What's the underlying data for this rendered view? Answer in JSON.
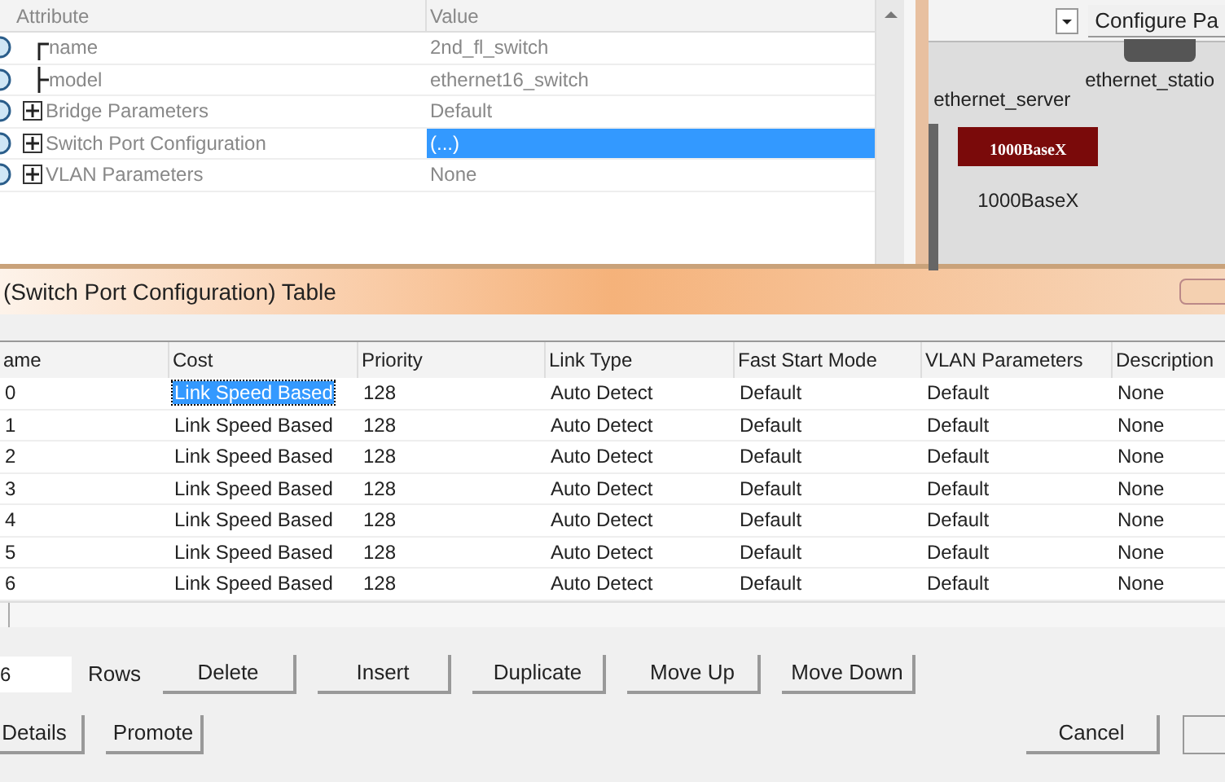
{
  "attributes_panel": {
    "columns": [
      "Attribute",
      "Value"
    ],
    "rows": [
      {
        "kind": "leaf",
        "attribute": "name",
        "value": "2nd_fl_switch",
        "selected": false
      },
      {
        "kind": "leaf",
        "attribute": "model",
        "value": "ethernet16_switch",
        "selected": false
      },
      {
        "kind": "group",
        "attribute": "Bridge Parameters",
        "value": "Default",
        "selected": false
      },
      {
        "kind": "group",
        "attribute": "Switch Port Configuration",
        "value": "(...)",
        "selected": true
      },
      {
        "kind": "group",
        "attribute": "VLAN Parameters",
        "value": "None",
        "selected": false
      }
    ]
  },
  "canvas": {
    "configure_button": "Configure Pa",
    "nodes": [
      "ethernet_server",
      "ethernet_statio"
    ],
    "link_badge": "1000BaseX",
    "link_label": "1000BaseX"
  },
  "dialog": {
    "title": "(Switch Port Configuration) Table",
    "table": {
      "columns": [
        "ame",
        "Cost",
        "Priority",
        "Link Type",
        "Fast Start Mode",
        "VLAN Parameters",
        "Description"
      ],
      "rows": [
        {
          "cells": [
            {
              "text": "0",
              "selected": false
            },
            {
              "text": "Link Speed Based",
              "selected": true
            },
            {
              "text": "128",
              "selected": false
            },
            {
              "text": "Auto Detect",
              "selected": false
            },
            {
              "text": "Default",
              "selected": false
            },
            {
              "text": "Default",
              "selected": false
            },
            {
              "text": "None",
              "selected": false
            }
          ]
        },
        {
          "cells": [
            {
              "text": "1",
              "selected": false
            },
            {
              "text": "Link Speed Based",
              "selected": false
            },
            {
              "text": "128",
              "selected": false
            },
            {
              "text": "Auto Detect",
              "selected": false
            },
            {
              "text": "Default",
              "selected": false
            },
            {
              "text": "Default",
              "selected": false
            },
            {
              "text": "None",
              "selected": false
            }
          ]
        },
        {
          "cells": [
            {
              "text": "2",
              "selected": false
            },
            {
              "text": "Link Speed Based",
              "selected": false
            },
            {
              "text": "128",
              "selected": false
            },
            {
              "text": "Auto Detect",
              "selected": false
            },
            {
              "text": "Default",
              "selected": false
            },
            {
              "text": "Default",
              "selected": false
            },
            {
              "text": "None",
              "selected": false
            }
          ]
        },
        {
          "cells": [
            {
              "text": "3",
              "selected": false
            },
            {
              "text": "Link Speed Based",
              "selected": false
            },
            {
              "text": "128",
              "selected": false
            },
            {
              "text": "Auto Detect",
              "selected": false
            },
            {
              "text": "Default",
              "selected": false
            },
            {
              "text": "Default",
              "selected": false
            },
            {
              "text": "None",
              "selected": false
            }
          ]
        },
        {
          "cells": [
            {
              "text": "4",
              "selected": false
            },
            {
              "text": "Link Speed Based",
              "selected": false
            },
            {
              "text": "128",
              "selected": false
            },
            {
              "text": "Auto Detect",
              "selected": false
            },
            {
              "text": "Default",
              "selected": false
            },
            {
              "text": "Default",
              "selected": false
            },
            {
              "text": "None",
              "selected": false
            }
          ]
        },
        {
          "cells": [
            {
              "text": "5",
              "selected": false
            },
            {
              "text": "Link Speed Based",
              "selected": false
            },
            {
              "text": "128",
              "selected": false
            },
            {
              "text": "Auto Detect",
              "selected": false
            },
            {
              "text": "Default",
              "selected": false
            },
            {
              "text": "Default",
              "selected": false
            },
            {
              "text": "None",
              "selected": false
            }
          ]
        },
        {
          "cells": [
            {
              "text": "6",
              "selected": false
            },
            {
              "text": "Link Speed Based",
              "selected": false
            },
            {
              "text": "128",
              "selected": false
            },
            {
              "text": "Auto Detect",
              "selected": false
            },
            {
              "text": "Default",
              "selected": false
            },
            {
              "text": "Default",
              "selected": false
            },
            {
              "text": "None",
              "selected": false
            }
          ]
        }
      ]
    },
    "rows_value": "6",
    "rows_label": "Rows",
    "row_buttons": [
      "Delete",
      "Insert",
      "Duplicate",
      "Move Up",
      "Move Down"
    ],
    "left_buttons": [
      "Details",
      "Promote"
    ],
    "right_buttons": [
      "Cancel"
    ]
  }
}
